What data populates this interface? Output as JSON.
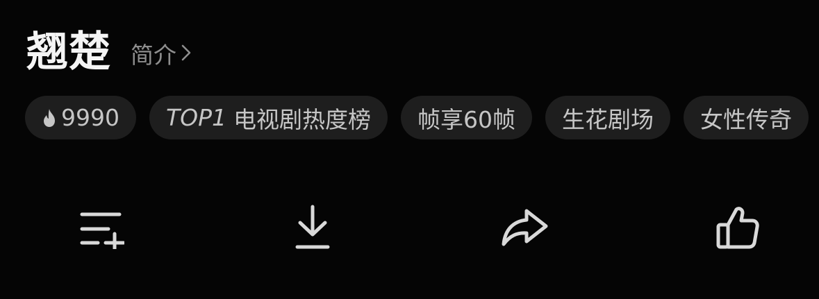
{
  "header": {
    "title": "翘楚",
    "intro_label": "简介"
  },
  "tags": {
    "heat_value": "9990",
    "ranking_prefix": "TOP1",
    "ranking_label": "电视剧热度榜",
    "frame_label": "帧享60帧",
    "studio_label": "生花剧场",
    "genre_label": "女性传奇"
  },
  "actions": {
    "icons": [
      "add-to-playlist-icon",
      "download-icon",
      "share-icon",
      "like-icon"
    ]
  },
  "colors": {
    "background": "#050505",
    "tag_background": "#1e1e1e",
    "title": "#f4f4f4",
    "muted_text": "#8e8e8e",
    "icon": "#d9d9d9"
  }
}
